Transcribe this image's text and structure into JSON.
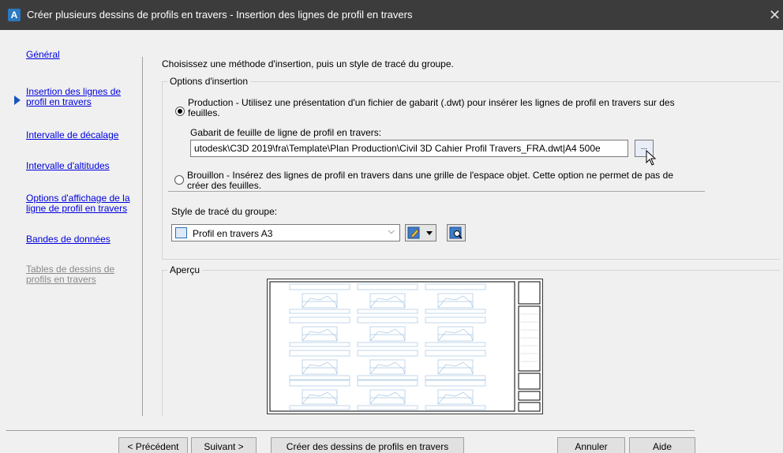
{
  "window": {
    "title": "Créer plusieurs dessins de profils en travers - Insertion des lignes de profil en travers",
    "app_icon": "A",
    "close_glyph": "✕"
  },
  "nav": {
    "items": [
      {
        "label": "Général"
      },
      {
        "label": "Insertion des lignes de profil en travers"
      },
      {
        "label": "Intervalle de décalage"
      },
      {
        "label": "Intervalle d'altitudes"
      },
      {
        "label": "Options d'affichage de la ligne de profil en travers"
      },
      {
        "label": "Bandes de données"
      },
      {
        "label": "Tables de dessins de profils en travers"
      }
    ]
  },
  "main": {
    "instruction": "Choisissez une méthode d'insertion, puis un style de tracé du groupe.",
    "insertion_options": {
      "label": "Options d'insertion",
      "production_text": "Production - Utilisez une présentation d'un fichier de gabarit (.dwt) pour insérer les lignes de profil en travers sur des feuilles.",
      "template_label": "Gabarit de feuille de ligne de profil en travers:",
      "template_value": "utodesk\\C3D 2019\\fra\\Template\\Plan Production\\Civil 3D Cahier Profil Travers_FRA.dwt|A4 500e",
      "browse_label": "...",
      "draft_text": "Brouillon - Insérez des lignes de profil en travers dans une grille de l'espace objet. Cette option ne permet de pas de créer des feuilles.",
      "selected": "production"
    },
    "group_style": {
      "label": "Style de tracé du groupe:",
      "value": "Profil en travers A3"
    },
    "preview": {
      "label": "Aperçu"
    }
  },
  "footer": {
    "previous": "< Précédent",
    "next": "Suivant >",
    "create": "Créer des dessins de profils en travers",
    "cancel": "Annuler",
    "help": "Aide"
  },
  "colors": {
    "titlebar": "#3c3c3c",
    "link": "#0000e0",
    "disabled": "#8a8a8a",
    "accent": "#1a56b8"
  }
}
